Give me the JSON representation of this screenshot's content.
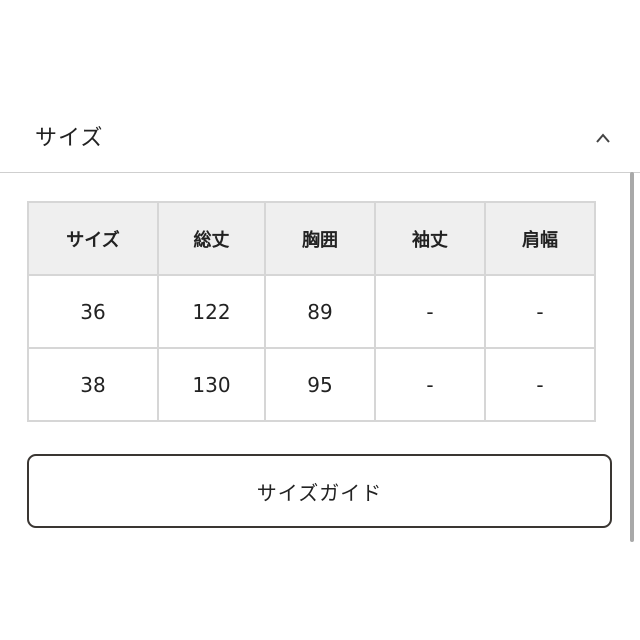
{
  "section": {
    "title": "サイズ",
    "toggle_icon": "chevron-up-icon"
  },
  "size_table": {
    "headers": [
      "サイズ",
      "総丈",
      "胸囲",
      "袖丈",
      "肩幅"
    ],
    "rows": [
      [
        "36",
        "122",
        "89",
        "-",
        "-"
      ],
      [
        "38",
        "130",
        "95",
        "-",
        "-"
      ]
    ]
  },
  "size_guide_button": {
    "label": "サイズガイド"
  },
  "colors": {
    "header_bg": "#efefef",
    "border": "#d6d6d6",
    "button_border": "#3a3632",
    "text": "#222222"
  }
}
